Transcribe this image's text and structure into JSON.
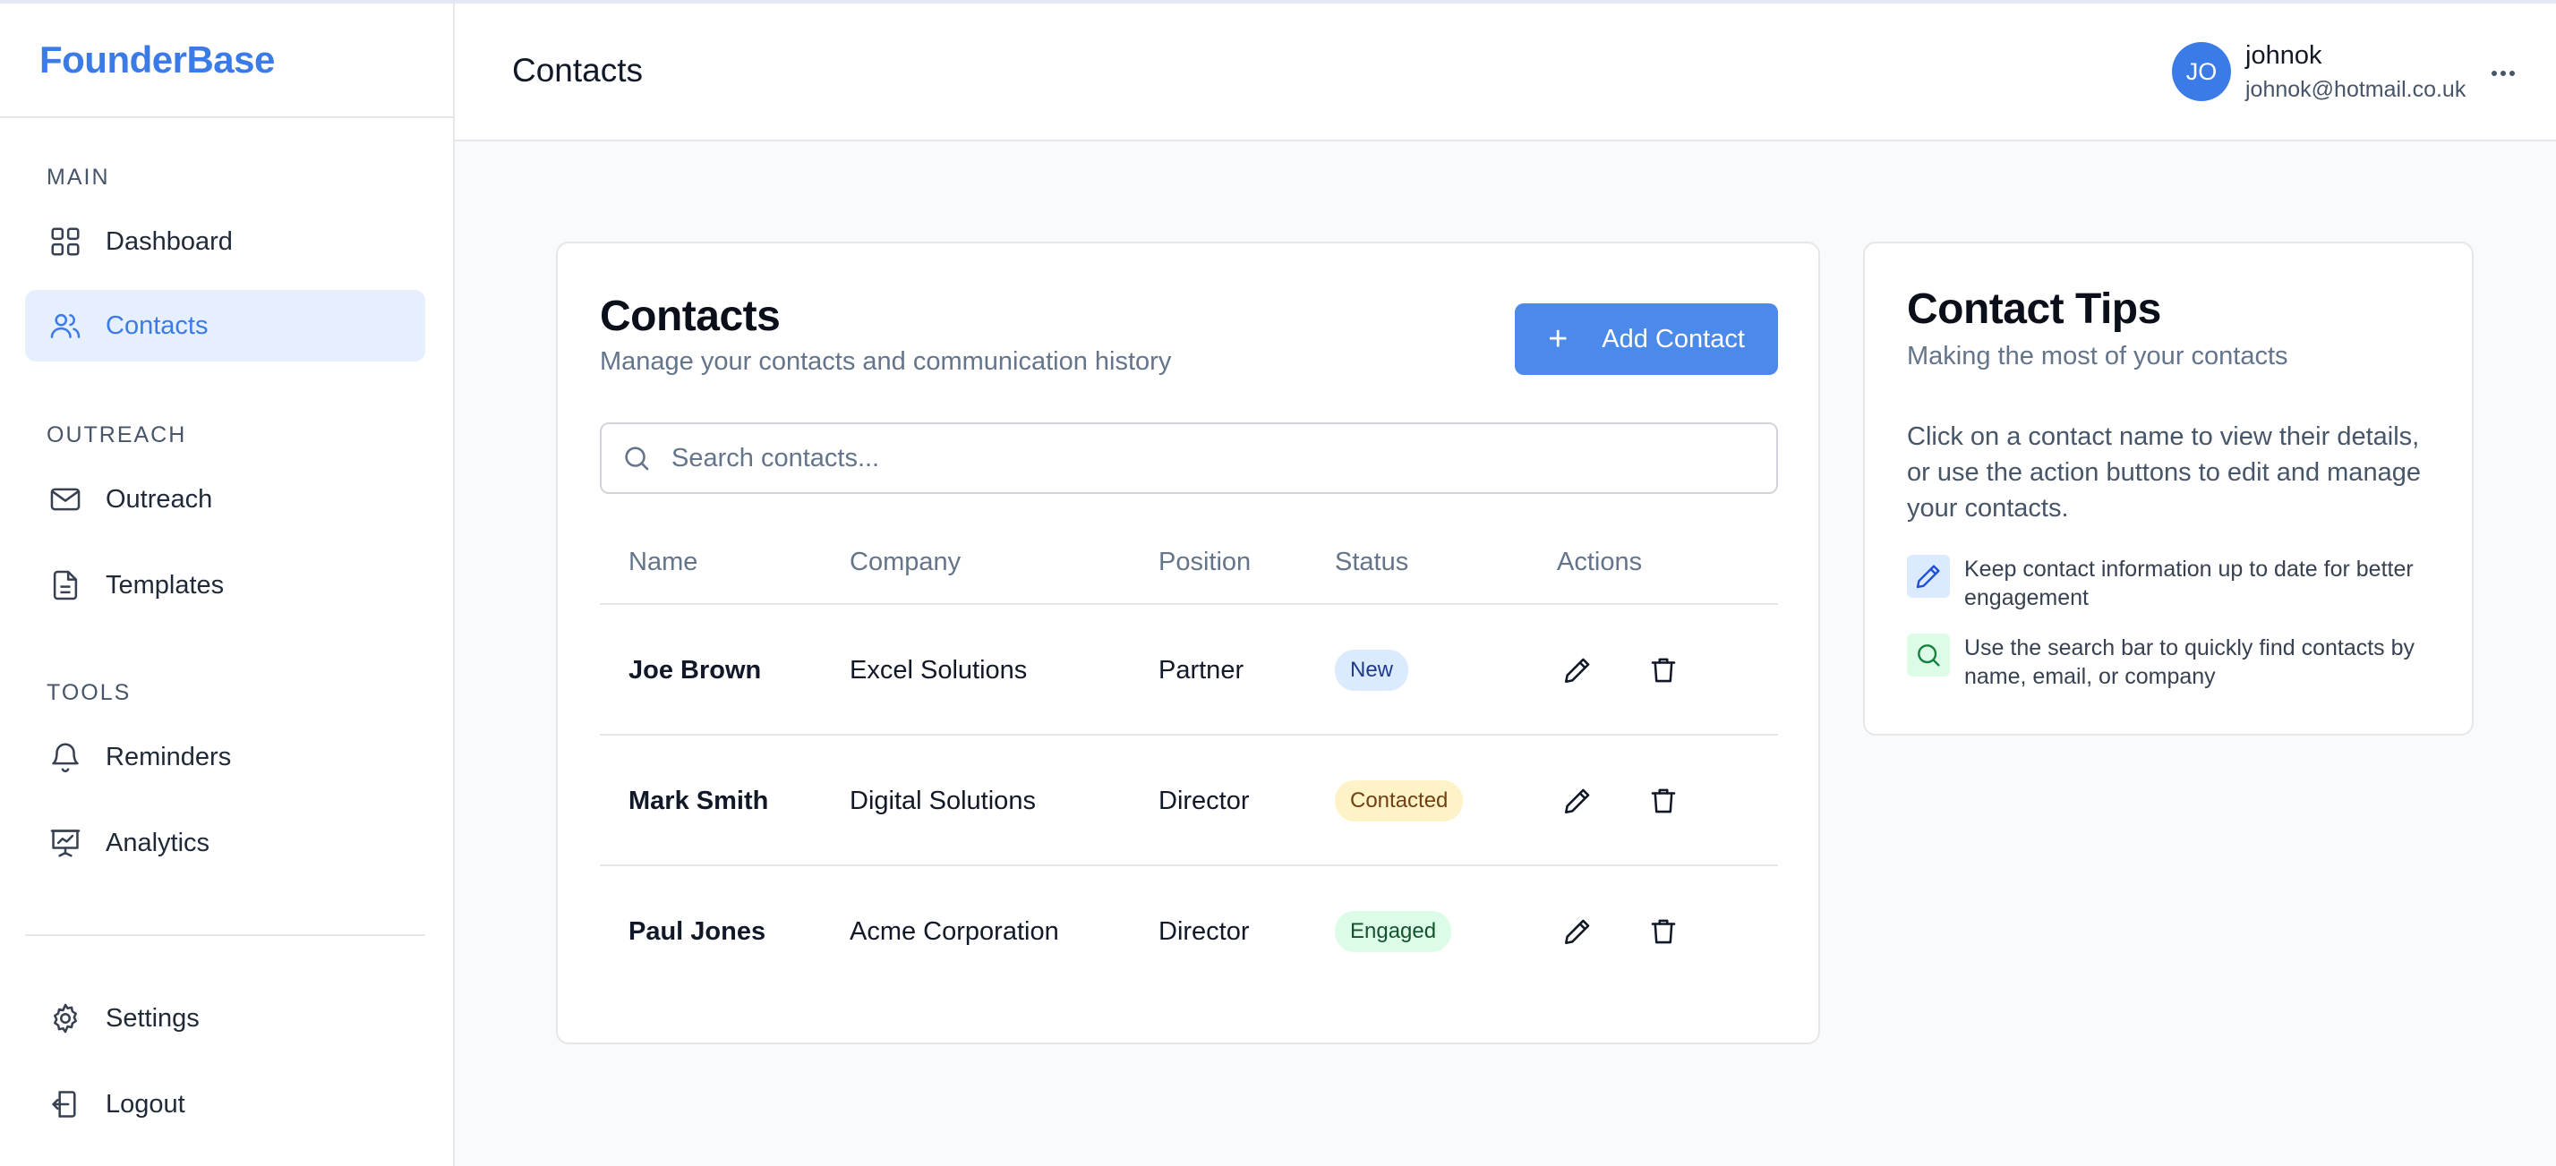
{
  "brand": "FounderBase",
  "sidebar": {
    "sections": {
      "main": "MAIN",
      "outreach": "OUTREACH",
      "tools": "TOOLS"
    },
    "items": {
      "dashboard": "Dashboard",
      "contacts": "Contacts",
      "outreach": "Outreach",
      "templates": "Templates",
      "reminders": "Reminders",
      "analytics": "Analytics",
      "settings": "Settings",
      "logout": "Logout"
    },
    "active": "contacts"
  },
  "header": {
    "title": "Contacts",
    "user": {
      "initials": "JO",
      "name": "johnok",
      "email": "johnok@hotmail.co.uk"
    }
  },
  "contacts_card": {
    "title": "Contacts",
    "subtitle": "Manage your contacts and communication history",
    "add_button": "Add Contact",
    "search_placeholder": "Search contacts...",
    "columns": [
      "Name",
      "Company",
      "Position",
      "Status",
      "Actions"
    ],
    "rows": [
      {
        "name": "Joe Brown",
        "company": "Excel Solutions",
        "position": "Partner",
        "status": "New"
      },
      {
        "name": "Mark Smith",
        "company": "Digital Solutions",
        "position": "Director",
        "status": "Contacted"
      },
      {
        "name": "Paul Jones",
        "company": "Acme Corporation",
        "position": "Director",
        "status": "Engaged"
      }
    ]
  },
  "tips_card": {
    "title": "Contact Tips",
    "subtitle": "Making the most of your contacts",
    "body": "Click on a contact name to view their details, or use the action buttons to edit and manage your contacts.",
    "tips": [
      {
        "icon": "pencil-icon",
        "text": "Keep contact information up to date for better engagement"
      },
      {
        "icon": "search-icon",
        "text": "Use the search bar to quickly find contacts by name, email, or company"
      }
    ]
  },
  "colors": {
    "accent": "#3b7be8",
    "button": "#4b89ea",
    "active_bg": "#e6effd",
    "badge_new": "#dbeafe",
    "badge_contacted": "#fef3c7",
    "badge_engaged": "#dcfce7"
  }
}
